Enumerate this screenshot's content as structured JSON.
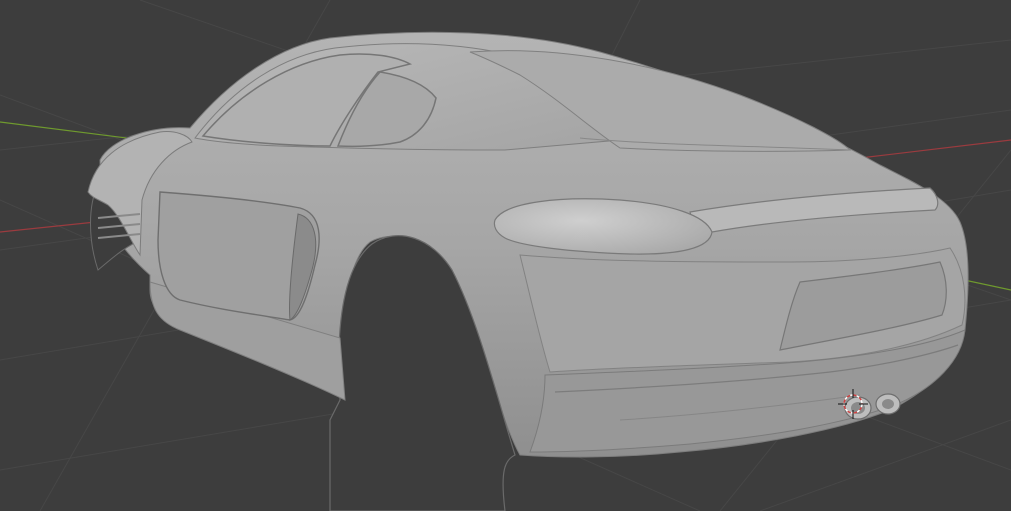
{
  "viewport": {
    "background_color": "#3d3d3d",
    "grid_color": "#474747",
    "x_axis_color": "#9b3b3f",
    "y_axis_color": "#6f9a2e",
    "model_color": "#a9a9a9"
  },
  "scene": {
    "model": "car-body",
    "cursor": "3d-cursor-icon"
  }
}
